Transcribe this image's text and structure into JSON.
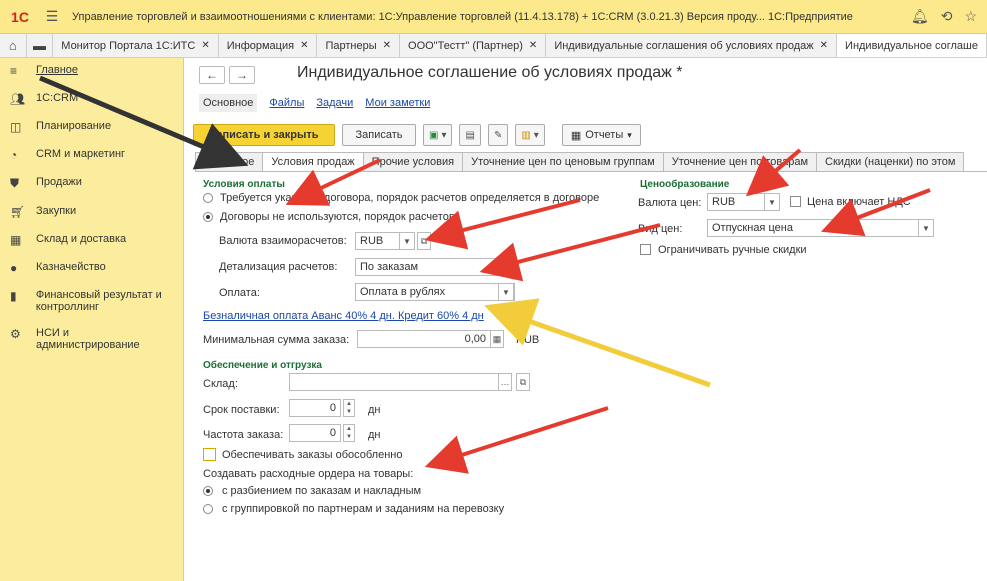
{
  "window": {
    "logo": "1С",
    "title": "Управление торговлей и взаимоотношениями с клиентами: 1С:Управление торговлей (11.4.13.178) + 1С:CRM (3.0.21.3) Версия проду... 1С:Предприятие"
  },
  "open_tabs": [
    {
      "label": "Монитор Портала 1С:ИТС"
    },
    {
      "label": "Информация"
    },
    {
      "label": "Партнеры"
    },
    {
      "label": "ООО\"Тестт\" (Партнер)"
    },
    {
      "label": "Индивидуальные соглашения об условиях продаж"
    },
    {
      "label": "Индивидуальное соглаше"
    }
  ],
  "sidebar": {
    "items": [
      {
        "label": "Главное",
        "icon": "menu-icon"
      },
      {
        "label": "1С:CRM",
        "icon": "people-icon"
      },
      {
        "label": "Планирование",
        "icon": "planning-icon"
      },
      {
        "label": "CRM и маркетинг",
        "icon": "pie-chart-icon"
      },
      {
        "label": "Продажи",
        "icon": "shopping-bag-icon"
      },
      {
        "label": "Закупки",
        "icon": "cart-icon"
      },
      {
        "label": "Склад и доставка",
        "icon": "warehouse-icon"
      },
      {
        "label": "Казначейство",
        "icon": "coin-icon"
      },
      {
        "label": "Финансовый результат и контроллинг",
        "icon": "bar-chart-icon"
      },
      {
        "label": "НСИ и администрирование",
        "icon": "gear-icon"
      }
    ]
  },
  "document": {
    "title": "Индивидуальное соглашение об условиях продаж *",
    "sublinks": [
      "Основное",
      "Файлы",
      "Задачи",
      "Мои заметки"
    ],
    "commands": {
      "save_close": "Записать и закрыть",
      "save": "Записать",
      "reports": "Отчеты"
    },
    "form_tabs": [
      "Основное",
      "Условия продаж",
      "Прочие условия",
      "Уточнение цен по ценовым группам",
      "Уточнение цен по товарам",
      "Скидки (наценки) по этом"
    ]
  },
  "payment": {
    "section_title": "Условия оплаты",
    "radio1": "Требуется указание договора, порядок расчетов определяется в договоре",
    "radio2": "Договоры не используются, порядок расчетов:",
    "currency_label": "Валюта взаиморасчетов:",
    "currency_value": "RUB",
    "detail_label": "Детализация расчетов:",
    "detail_value": "По заказам",
    "payment_label": "Оплата:",
    "payment_value": "Оплата в рублях",
    "schedule_link": "Безналичная оплата Аванс 40% 4 дн. Кредит 60% 4 дн",
    "min_sum_label": "Минимальная сумма заказа:",
    "min_sum_value": "0,00",
    "min_sum_currency": "RUB"
  },
  "pricing": {
    "section_title": "Ценообразование",
    "currency_label": "Валюта цен:",
    "currency_value": "RUB",
    "includes_vat": "Цена включает НДС",
    "price_type_label": "Вид цен:",
    "price_type_value": "Отпускная цена",
    "limit_manual": "Ограничивать ручные скидки"
  },
  "shipping": {
    "section_title": "Обеспечение и отгрузка",
    "warehouse_label": "Склад:",
    "warehouse_value": "",
    "delivery_label": "Срок поставки:",
    "delivery_value": "0",
    "delivery_unit": "дн",
    "freq_label": "Частота заказа:",
    "freq_value": "0",
    "freq_unit": "дн",
    "separate": "Обеспечивать заказы обособленно",
    "orders_label": "Создавать расходные ордера на товары:",
    "orders_opt1": "с разбиением по заказам и накладным",
    "orders_opt2": "с группировкой по партнерам и заданиям на перевозку"
  },
  "annotation_colors": {
    "red_arrow": "#e53a2e",
    "yellow_arrow": "#f3cc3c",
    "dark_arrow": "#333333"
  }
}
